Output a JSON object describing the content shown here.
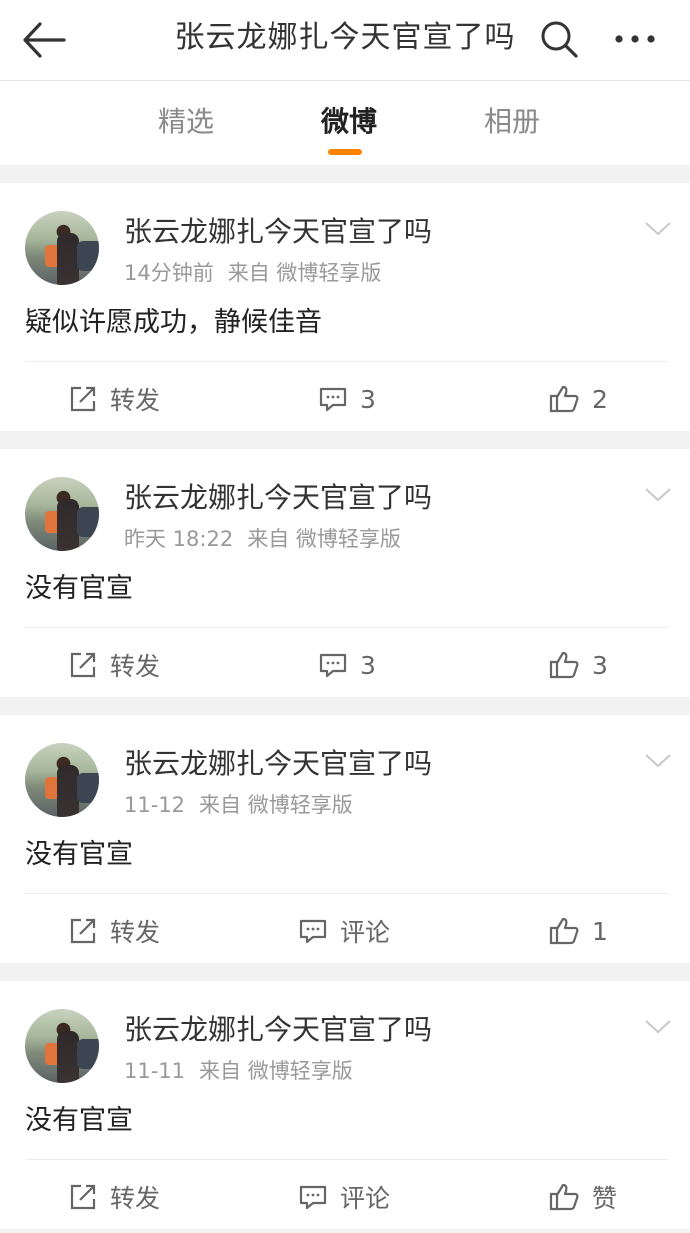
{
  "header": {
    "title": "张云龙娜扎今天官宣了吗",
    "back_icon": "back-arrow-icon",
    "search_icon": "search-icon",
    "more_icon": "more-icon"
  },
  "tabs": [
    {
      "label": "精选",
      "active": false
    },
    {
      "label": "微博",
      "active": true
    },
    {
      "label": "相册",
      "active": false
    }
  ],
  "accent_color": "#ff8200",
  "posts": [
    {
      "author": "张云龙娜扎今天官宣了吗",
      "time": "14分钟前",
      "source": "来自 微博轻享版",
      "text": "疑似许愿成功，静候佳音",
      "repost_label": "转发",
      "comment_label": "3",
      "like_label": "2"
    },
    {
      "author": "张云龙娜扎今天官宣了吗",
      "time": "昨天 18:22",
      "source": "来自 微博轻享版",
      "text": "没有官宣",
      "repost_label": "转发",
      "comment_label": "3",
      "like_label": "3"
    },
    {
      "author": "张云龙娜扎今天官宣了吗",
      "time": "11-12",
      "source": "来自 微博轻享版",
      "text": "没有官宣",
      "repost_label": "转发",
      "comment_label": "评论",
      "like_label": "1"
    },
    {
      "author": "张云龙娜扎今天官宣了吗",
      "time": "11-11",
      "source": "来自 微博轻享版",
      "text": "没有官宣",
      "repost_label": "转发",
      "comment_label": "评论",
      "like_label": "赞"
    }
  ]
}
